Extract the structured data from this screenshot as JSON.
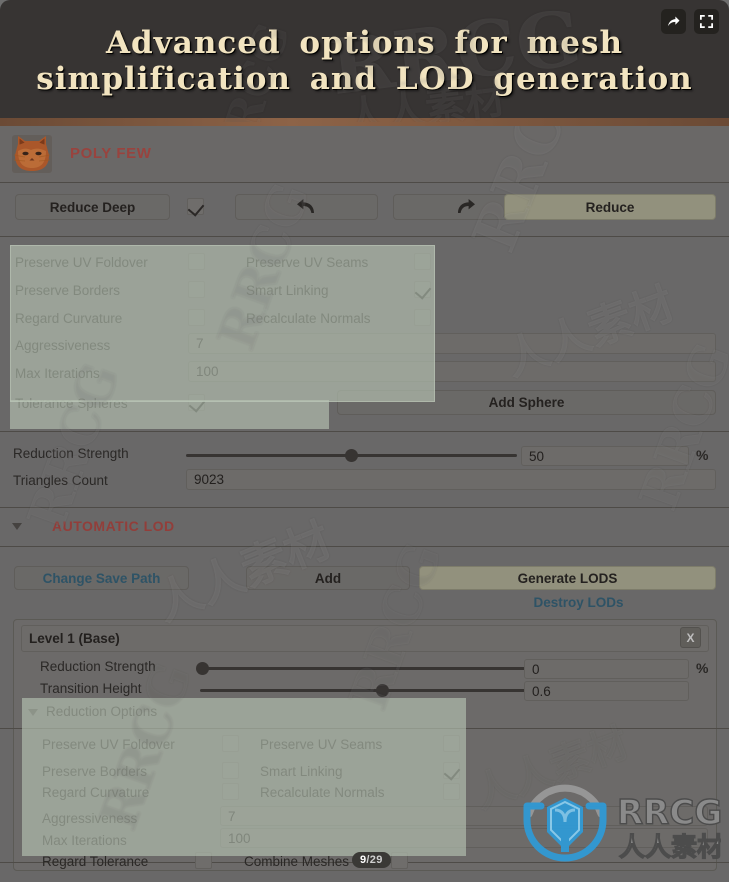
{
  "banner": {
    "line1": "Advanced  options  for  mesh",
    "line2": "simplification  and  LOD  generation",
    "share_icon": "share-arrow-icon",
    "fullscreen_icon": "fullscreen-icon"
  },
  "header": {
    "title": "POLY FEW",
    "logo_icon": "cat-face-logo"
  },
  "toolbar": {
    "reduce_deep_label": "Reduce Deep",
    "reduce_deep_checked": true,
    "undo_icon": "undo-arrow-icon",
    "redo_icon": "redo-arrow-icon",
    "reduce_label": "Reduce"
  },
  "reduction_options": {
    "checkboxes": [
      {
        "label": "Preserve UV Foldover",
        "checked": false
      },
      {
        "label": "Preserve UV Seams",
        "checked": false
      },
      {
        "label": "Preserve Borders",
        "checked": false
      },
      {
        "label": "Smart Linking",
        "checked": true
      },
      {
        "label": "Regard Curvature",
        "checked": false
      },
      {
        "label": "Recalculate Normals",
        "checked": false
      }
    ],
    "aggressiveness_label": "Aggressiveness",
    "aggressiveness_value": "7",
    "max_iterations_label": "Max Iterations",
    "max_iterations_value": "100",
    "tolerance_spheres_label": "Tolerance Spheres",
    "tolerance_spheres_checked": true,
    "add_sphere_label": "Add Sphere"
  },
  "reduction": {
    "strength_label": "Reduction Strength",
    "strength_value": "50",
    "strength_percent": 50,
    "percent_sign": "%",
    "triangles_label": "Triangles Count",
    "triangles_value": "9023"
  },
  "auto_lod": {
    "section_title": "AUTOMATIC LOD",
    "change_save_path_label": "Change Save Path",
    "add_label": "Add",
    "generate_lods_label": "Generate LODS",
    "destroy_lods_label": "Destroy LODs",
    "level": {
      "title": "Level 1 (Base)",
      "close_label": "X",
      "strength_label": "Reduction Strength",
      "strength_value": "0",
      "strength_percent": 0,
      "percent_sign": "%",
      "transition_label": "Transition Height",
      "transition_value": "0.6",
      "transition_percent": 57,
      "options_title": "Reduction Options",
      "checkboxes": [
        {
          "label": "Preserve UV Foldover",
          "checked": false
        },
        {
          "label": "Preserve UV Seams",
          "checked": false
        },
        {
          "label": "Preserve Borders",
          "checked": false
        },
        {
          "label": "Smart Linking",
          "checked": true
        },
        {
          "label": "Regard Curvature",
          "checked": false
        },
        {
          "label": "Recalculate Normals",
          "checked": false
        }
      ],
      "aggressiveness_label": "Aggressiveness",
      "aggressiveness_value": "7",
      "max_iterations_label": "Max Iterations",
      "max_iterations_value": "100",
      "regard_tolerance_label": "Regard Tolerance",
      "regard_tolerance_checked": false,
      "combine_meshes_label": "Combine Meshes",
      "combine_meshes_checked": false
    }
  },
  "overlay": {
    "page_current": "9",
    "page_separator": "/",
    "page_total": "29",
    "watermark_latin": "RRCG",
    "watermark_cn": "人人素材",
    "brand_text": "RRCG",
    "brand_cn": "人人素材"
  },
  "colors": {
    "banner_bg": "#373433",
    "banner_text": "#f2e4c0",
    "panel_bg": "#767676",
    "accent_red": "#b04a44",
    "section_red": "#a8443f",
    "link_blue": "#2f5d74",
    "accent_button": "#a8a890",
    "highlight": "#d6e7d3",
    "logo_blue": "#2f9bd8"
  }
}
